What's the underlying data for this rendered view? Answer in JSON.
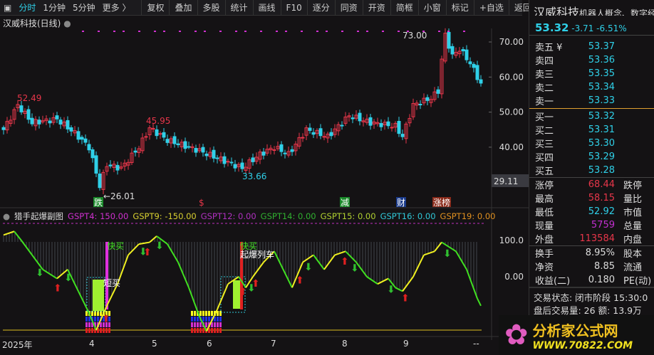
{
  "toolbar": {
    "items": [
      "分时",
      "1分钟",
      "5分钟",
      "更多 〉"
    ],
    "buttons": [
      "复权",
      "叠加",
      "多股",
      "统计",
      "画线",
      "F10",
      "逐分",
      "同资",
      "开资",
      "简框",
      "小窗",
      "标记",
      "+自选",
      "返回"
    ]
  },
  "chart_title": "汉威科技(日线)",
  "price_axis": [
    "70.00",
    "60.00",
    "50.00",
    "40.00"
  ],
  "current_axis_label": "29.11",
  "annotations": {
    "high1": "52.49",
    "low1": "←26.01",
    "high2": "45.95",
    "low2": "33.66",
    "top": "73.00"
  },
  "events": [
    "跌",
    "$",
    "减",
    "财",
    "涨榜"
  ],
  "indicator": {
    "name": "猎手起爆副图",
    "values": [
      {
        "label": "GSPT4: 150.00",
        "color": "#d030d0"
      },
      {
        "label": "GSPT9: -150.00",
        "color": "#d8d030"
      },
      {
        "label": "GSPT12: 0.00",
        "color": "#b030c0"
      },
      {
        "label": "GSPT14: 0.00",
        "color": "#30b030"
      },
      {
        "label": "GSPT15: 0.00",
        "color": "#b0d030"
      },
      {
        "label": "GSPT16: 0.00",
        "color": "#30c8d8"
      },
      {
        "label": "GSPT19: 0.00",
        "color": "#e09020"
      }
    ],
    "axis": [
      "100.0",
      "0.00"
    ],
    "marks": [
      "快买",
      "短买",
      "快买",
      "起爆列车"
    ]
  },
  "x_axis": [
    "2025年",
    "4",
    "5",
    "6",
    "7",
    "8",
    "9",
    "--"
  ],
  "price_path": [
    [
      0,
      45
    ],
    [
      4,
      52
    ],
    [
      8,
      47
    ],
    [
      15,
      48
    ],
    [
      20,
      44
    ],
    [
      24,
      40
    ],
    [
      27,
      29
    ],
    [
      29,
      35
    ],
    [
      33,
      34
    ],
    [
      38,
      40
    ],
    [
      41,
      45.5
    ],
    [
      46,
      42
    ],
    [
      55,
      39
    ],
    [
      67,
      34
    ],
    [
      72,
      38
    ],
    [
      76,
      40
    ],
    [
      80,
      38
    ],
    [
      85,
      45
    ],
    [
      91,
      43
    ],
    [
      97,
      49
    ],
    [
      103,
      47
    ],
    [
      110,
      46
    ],
    [
      112,
      43
    ],
    [
      115,
      52
    ],
    [
      120,
      54
    ],
    [
      122,
      56
    ],
    [
      123,
      65
    ],
    [
      124,
      72
    ],
    [
      126,
      66
    ],
    [
      128,
      68
    ],
    [
      131,
      64
    ],
    [
      134,
      58
    ]
  ],
  "osc_path": [
    [
      0,
      115
    ],
    [
      3,
      125
    ],
    [
      5,
      100
    ],
    [
      8,
      60
    ],
    [
      11,
      20
    ],
    [
      15,
      -5
    ],
    [
      18,
      20
    ],
    [
      21,
      -40
    ],
    [
      24,
      -100
    ],
    [
      26,
      -147
    ],
    [
      29,
      -80
    ],
    [
      32,
      -20
    ],
    [
      35,
      60
    ],
    [
      38,
      90
    ],
    [
      41,
      95
    ],
    [
      43,
      112
    ],
    [
      46,
      90
    ],
    [
      49,
      40
    ],
    [
      52,
      -30
    ],
    [
      55,
      -110
    ],
    [
      57,
      -150
    ],
    [
      60,
      -90
    ],
    [
      63,
      -20
    ],
    [
      66,
      0
    ],
    [
      68,
      -30
    ],
    [
      70,
      0
    ],
    [
      73,
      40
    ],
    [
      76,
      70
    ],
    [
      78,
      30
    ],
    [
      81,
      -30
    ],
    [
      84,
      40
    ],
    [
      87,
      60
    ],
    [
      90,
      20
    ],
    [
      93,
      60
    ],
    [
      96,
      70
    ],
    [
      99,
      40
    ],
    [
      102,
      0
    ],
    [
      105,
      -20
    ],
    [
      108,
      -5
    ],
    [
      110,
      -30
    ],
    [
      112,
      -40
    ],
    [
      115,
      0
    ],
    [
      118,
      60
    ],
    [
      121,
      70
    ],
    [
      123,
      95
    ],
    [
      127,
      70
    ],
    [
      130,
      20
    ],
    [
      133,
      -60
    ],
    [
      134,
      -80
    ]
  ],
  "quote": {
    "name": "汉威科技",
    "concept": "机器人概念、数字经",
    "price": "53.32",
    "change": "-3.71",
    "pct": "-6.51%",
    "asks": [
      [
        "卖五 ¥",
        "53.37"
      ],
      [
        "卖四",
        "53.36"
      ],
      [
        "卖三",
        "53.35"
      ],
      [
        "卖二",
        "53.34"
      ],
      [
        "卖一",
        "53.33"
      ]
    ],
    "bids": [
      [
        "买一",
        "53.32"
      ],
      [
        "买二",
        "53.31"
      ],
      [
        "买三",
        "53.30"
      ],
      [
        "买四",
        "53.29"
      ],
      [
        "买五",
        "53.28"
      ]
    ],
    "stats": [
      [
        "涨停",
        "68.44",
        "跌停",
        "rd"
      ],
      [
        "最高",
        "58.15",
        "量比",
        "rd"
      ],
      [
        "最低",
        "52.92",
        "市值",
        "cy"
      ],
      [
        "现量",
        "5759",
        "总量",
        "pu"
      ],
      [
        "外盘",
        "113584",
        "内盘",
        "rd"
      ]
    ],
    "stats2": [
      [
        "换手",
        "8.95%",
        "股本"
      ],
      [
        "净资",
        "8.85",
        "流通"
      ],
      [
        "收益(二)",
        "0.180",
        "PE(动)"
      ]
    ],
    "status": "交易状态: 闭市阶段 15:30:0",
    "after": "盘后交易量: 26  额: 13.9万"
  },
  "logo": {
    "text": "分析家公式网",
    "url": "WWW.70822.COM"
  }
}
